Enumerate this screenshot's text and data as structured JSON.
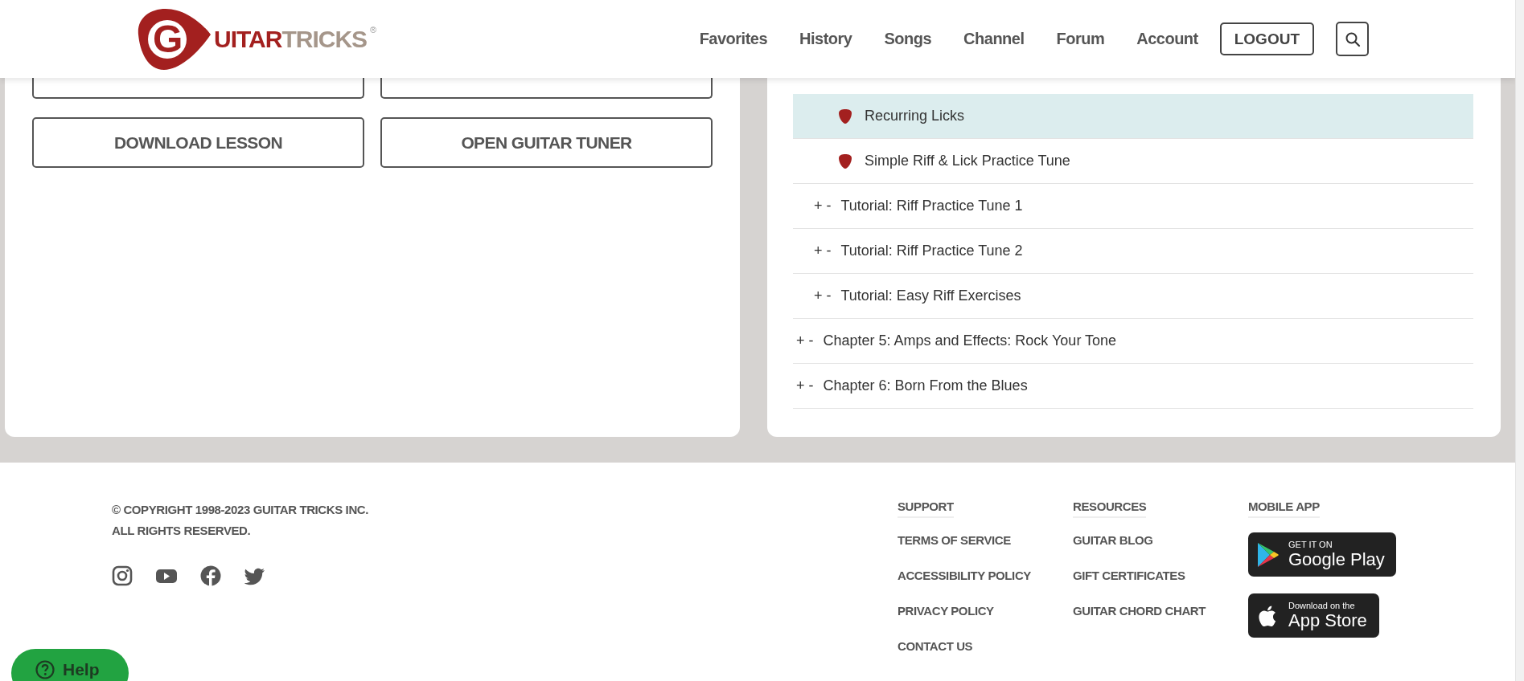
{
  "header": {
    "logo": {
      "letter": "G",
      "word_1": "UITAR",
      "word_2": "TRICKS",
      "mark": "®"
    },
    "nav": [
      {
        "label": "Favorites"
      },
      {
        "label": "History"
      },
      {
        "label": "Songs"
      },
      {
        "label": "Channel"
      },
      {
        "label": "Forum"
      },
      {
        "label": "Account"
      }
    ],
    "logout": "LOGOUT"
  },
  "lesson_actions": [
    {
      "kind": "hidden"
    },
    {
      "kind": "hidden"
    },
    {
      "label": "DOWNLOAD LESSON",
      "kind": "shown"
    },
    {
      "label": "OPEN GUITAR TUNER",
      "kind": "shown"
    }
  ],
  "outline": [
    {
      "children": [
        {
          "children": [
            {
              "label": "Recurring Licks",
              "kind": "lesson",
              "selected": true
            },
            {
              "label": "Simple Riff & Lick Practice Tune",
              "kind": "lesson",
              "selected": false
            }
          ]
        },
        {
          "label": "Tutorial: Riff Practice Tune 1",
          "kind": "group",
          "toggle": "+ -",
          "selected": false
        },
        {
          "label": "Tutorial: Riff Practice Tune 2",
          "kind": "group",
          "toggle": "+ -",
          "selected": false
        },
        {
          "label": "Tutorial: Easy Riff Exercises",
          "kind": "group",
          "toggle": "+ -",
          "selected": false
        }
      ]
    },
    {
      "label": "Chapter 5: Amps and Effects: Rock Your Tone",
      "kind": "group",
      "toggle": "+ -",
      "selected": false
    },
    {
      "label": "Chapter 6: Born From the Blues",
      "kind": "group",
      "toggle": "+ -",
      "selected": false
    }
  ],
  "footer": {
    "copyright": [
      "© COPYRIGHT 1998-2023 GUITAR TRICKS INC.",
      "ALL RIGHTS RESERVED."
    ],
    "social": [
      {
        "kind": "instagram"
      },
      {
        "kind": "youtube"
      },
      {
        "kind": "facebook"
      },
      {
        "kind": "twitter"
      }
    ],
    "columns": [
      {
        "heading": "SUPPORT",
        "links": [
          "TERMS OF SERVICE",
          "ACCESSIBILITY POLICY",
          "PRIVACY POLICY",
          "CONTACT US"
        ]
      },
      {
        "heading": "RESOURCES",
        "links": [
          "GUITAR BLOG",
          "GIFT CERTIFICATES",
          "GUITAR CHORD CHART"
        ]
      }
    ],
    "mobile_app": {
      "heading": "MOBILE APP",
      "badges": [
        {
          "kind": "google",
          "small": "GET IT ON",
          "big": "Google Play"
        },
        {
          "kind": "apple",
          "small": "Download on the",
          "big": "App Store"
        }
      ]
    }
  },
  "help": "Help"
}
